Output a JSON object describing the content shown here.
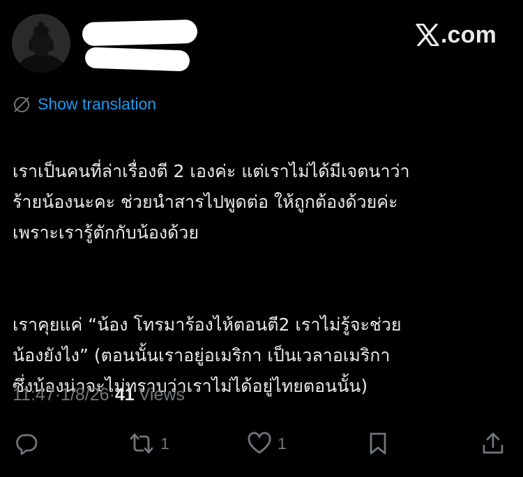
{
  "author": {
    "display_name": "",
    "handle": "",
    "avatar_icon": "buddha-avatar"
  },
  "brand": {
    "text": ".com",
    "icon": "x-logo-icon"
  },
  "translation": {
    "label": "Show translation",
    "icon": "translate-globe-icon",
    "color": "#1d9bf0"
  },
  "post": {
    "paragraphs": [
      "เราเป็นคนที่ล่าเรื่องตี 2 เองค่ะ แต่เราไม่ได้มีเจตนาว่า\nร้ายน้องนะคะ ช่วยนำสารไปพูดต่อ ให้ถูกต้องด้วยค่ะ\nเพราะเรารู้ตักกับน้องด้วย",
      "เราคุยแค่ “น้อง โทรมาร้องไห้ตอนตี2 เราไม่รู้จะช่วย\nน้องยังไง” (ตอนนั้นเราอยู่อเมริกา เป็นเวลาอเมริกา\nซึ่งน้องน่าจะไม่ทราบว่าเราไม่ได้อยู่ไทยตอนนั้น)"
    ]
  },
  "meta": {
    "time": "11:47",
    "sep1": " · ",
    "date": "1/8/26",
    "sep2": " · ",
    "views_count": "41",
    "views_label": "Views"
  },
  "actions": {
    "reply": {
      "icon": "reply-icon",
      "count": ""
    },
    "repost": {
      "icon": "repost-icon",
      "count": "1"
    },
    "like": {
      "icon": "heart-icon",
      "count": "1"
    },
    "bookmark": {
      "icon": "bookmark-icon",
      "count": ""
    },
    "share": {
      "icon": "share-icon",
      "count": ""
    }
  },
  "colors": {
    "background": "#000000",
    "text": "#e7e9ea",
    "muted": "#71767b",
    "accent": "#1d9bf0"
  }
}
